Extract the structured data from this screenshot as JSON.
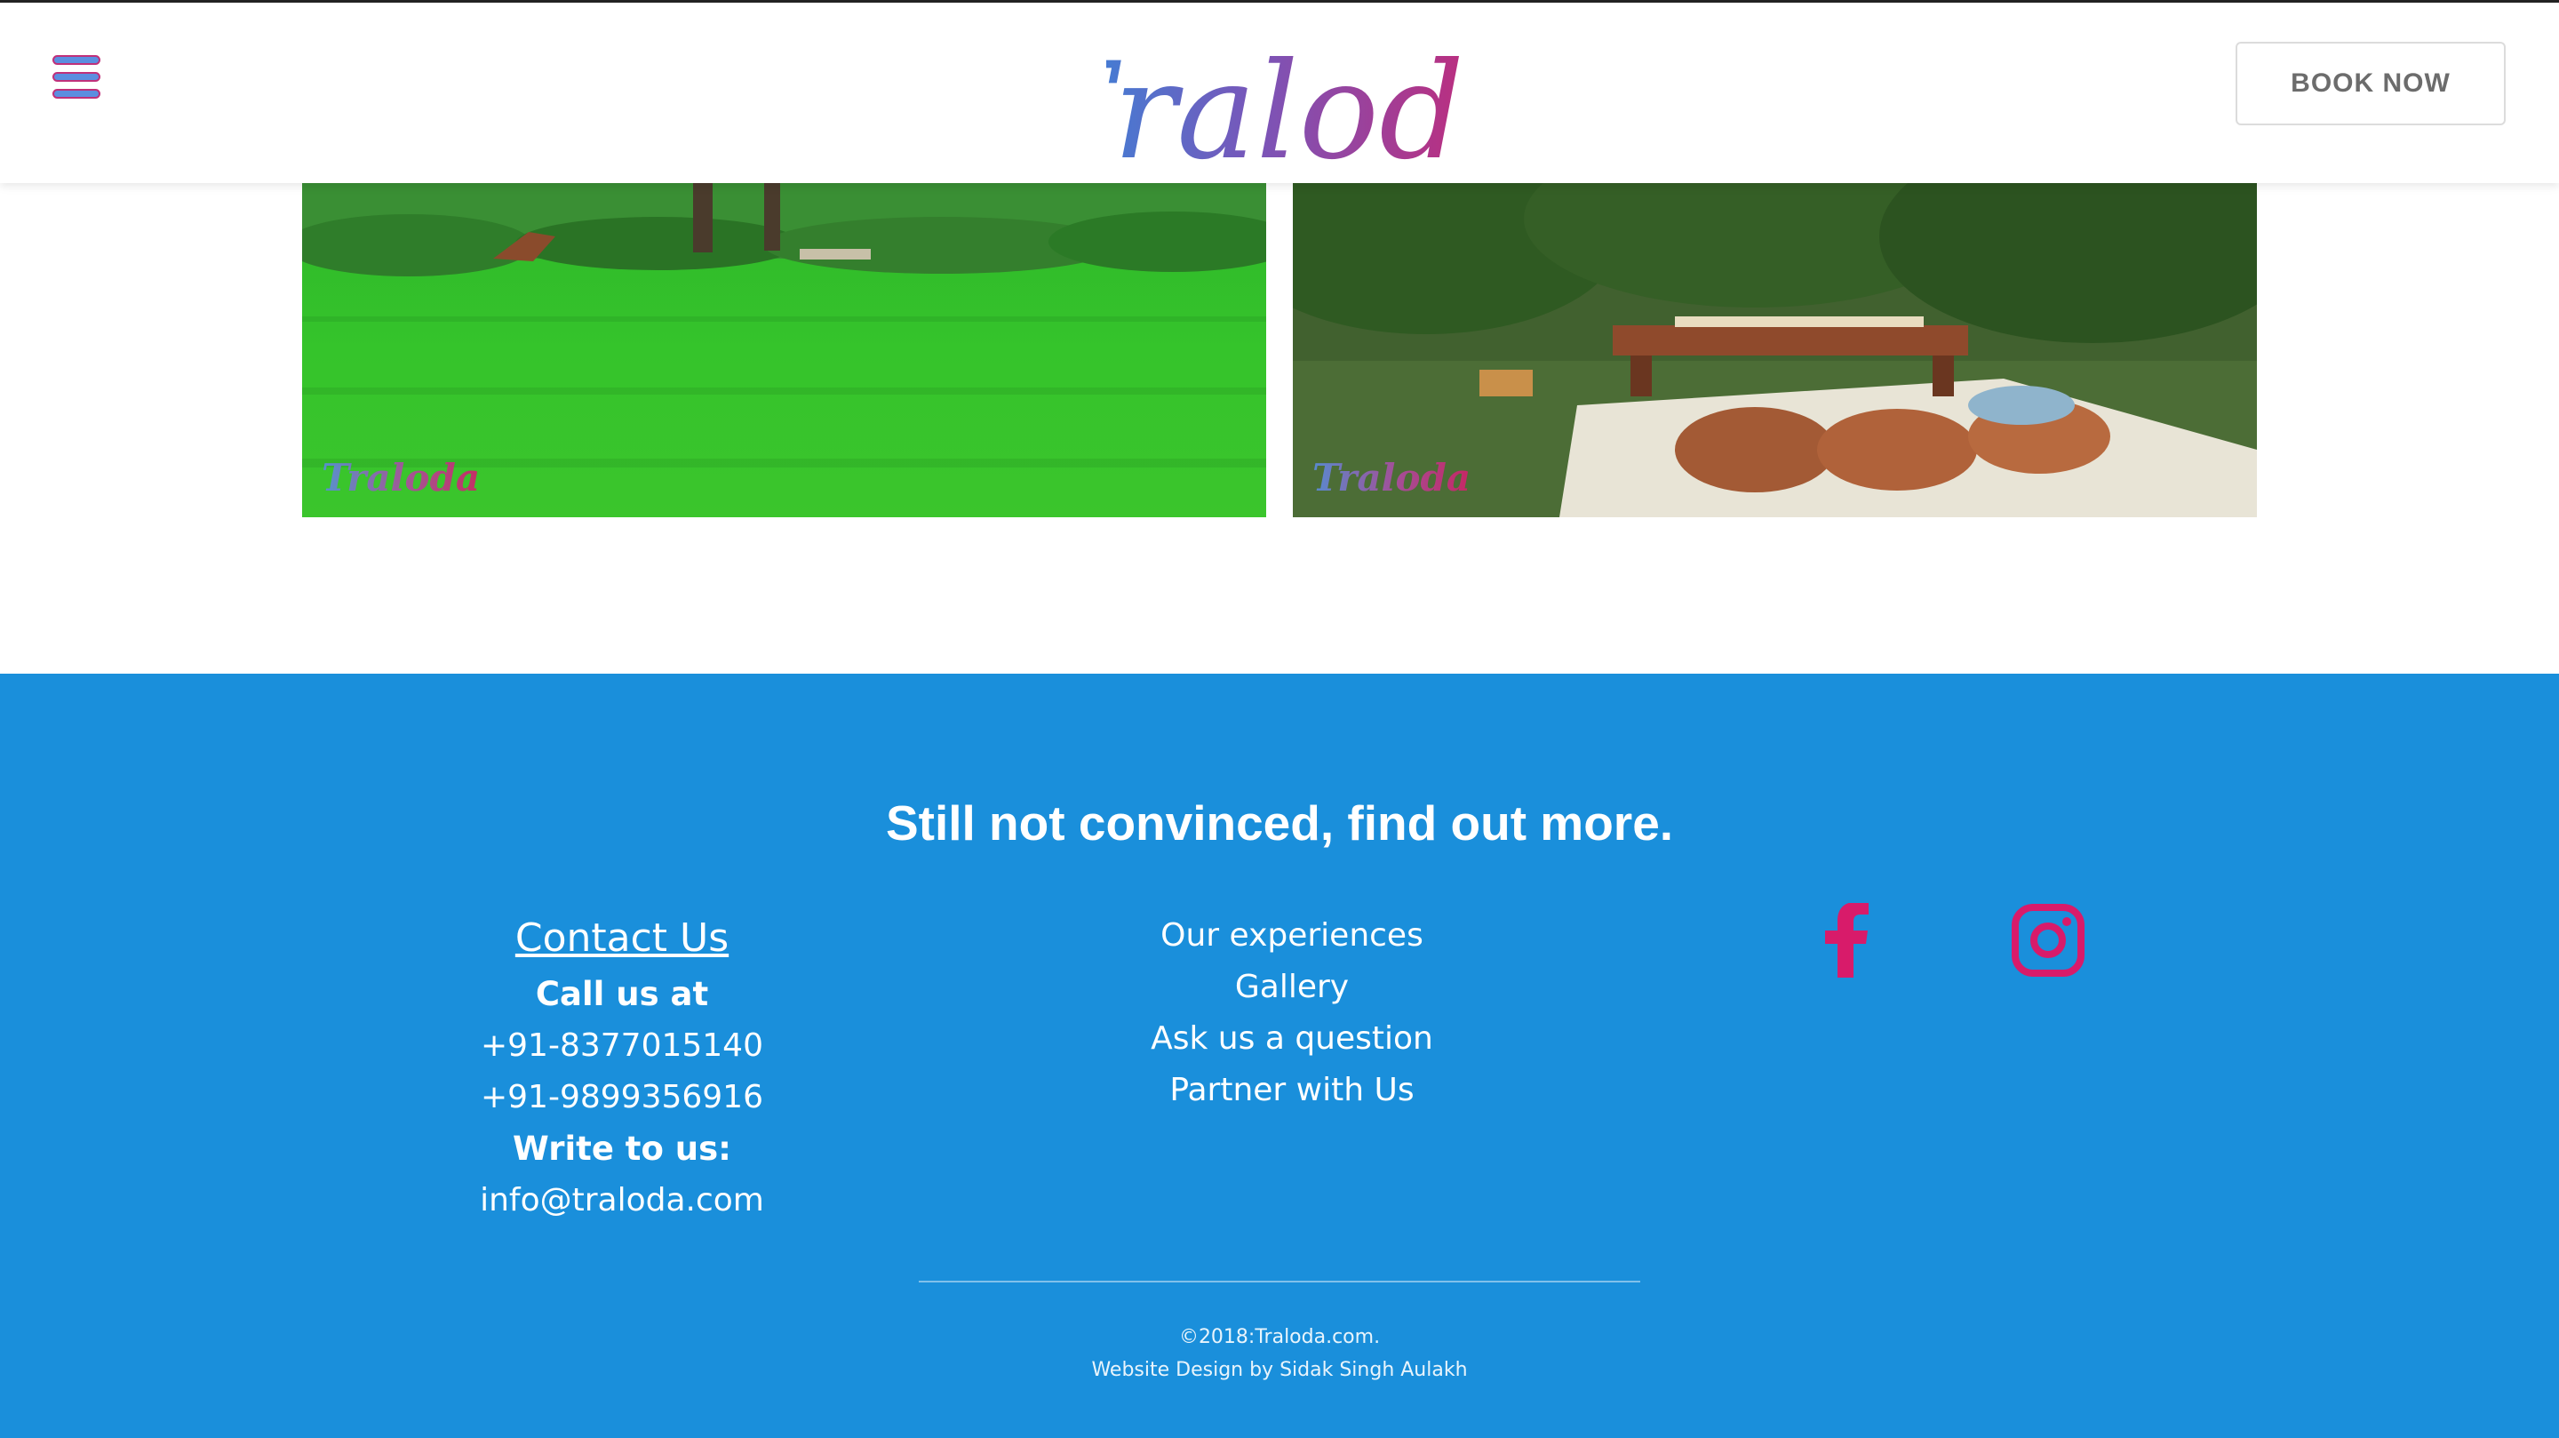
{
  "header": {
    "logo_text": "Traloda",
    "book_button": "BOOK NOW",
    "menu_icon": "hamburger-menu-icon"
  },
  "gallery": {
    "images": [
      {
        "alt": "Green lawn in a park with a picnic setup in the distance",
        "watermark": "Traloda"
      },
      {
        "alt": "Picnic setup on a white sheet with bolster cushions and a wooden bench",
        "watermark": "Traloda"
      }
    ]
  },
  "footer": {
    "tagline": "Still not convinced, find out more.",
    "contact": {
      "title": "Contact Us",
      "call_label": "Call us at",
      "phone_1": "+91-8377015140",
      "phone_2": "+91-9899356916",
      "write_label": "Write to us:",
      "email": "info@traloda.com"
    },
    "links": [
      "Our experiences",
      "Gallery",
      "Ask us a question",
      "Partner with Us"
    ],
    "social": [
      {
        "icon": "facebook-icon"
      },
      {
        "icon": "instagram-icon"
      }
    ],
    "copyright": "©2018:Traloda.com.",
    "credit": "Website Design by Sidak Singh Aulakh"
  },
  "colors": {
    "footer_bg": "#1a8fdb",
    "social_icons": "#d81b6a",
    "logo_gradient": [
      "#2b8fe0",
      "#7a55b8",
      "#d3206a"
    ]
  }
}
